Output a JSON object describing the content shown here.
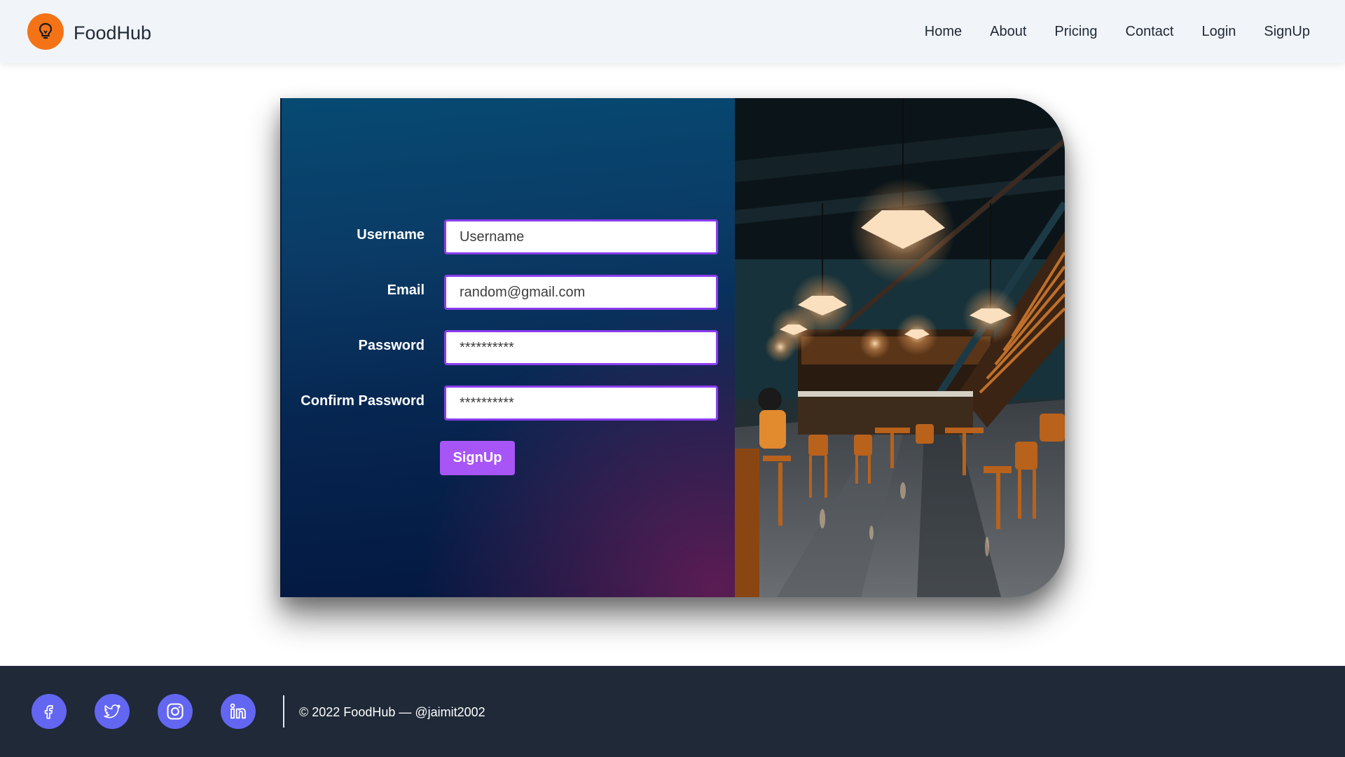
{
  "header": {
    "brand": "FoodHub",
    "logo_icon": "lightbulb-icon",
    "nav": [
      "Home",
      "About",
      "Pricing",
      "Contact",
      "Login",
      "SignUp"
    ]
  },
  "form": {
    "fields": [
      {
        "label": "Username",
        "placeholder": "Username",
        "value": "",
        "type": "text"
      },
      {
        "label": "Email",
        "placeholder": "random@gmail.com",
        "value": "",
        "type": "email"
      },
      {
        "label": "Password",
        "placeholder": "**********",
        "value": "",
        "type": "password"
      },
      {
        "label": "Confirm Password",
        "placeholder": "**********",
        "value": "",
        "type": "password"
      }
    ],
    "submit_label": "SignUp"
  },
  "footer": {
    "social_icons": [
      "facebook-icon",
      "twitter-icon",
      "instagram-icon",
      "linkedin-icon"
    ],
    "copyright": "© 2022 FoodHub — @jaimit2002"
  },
  "colors": {
    "accent": "#a855f7",
    "input_border": "#8b3df0",
    "logo": "#f47317",
    "social": "#6366f1",
    "footer_bg": "#1f2937",
    "header_bg": "#f1f4f8"
  }
}
